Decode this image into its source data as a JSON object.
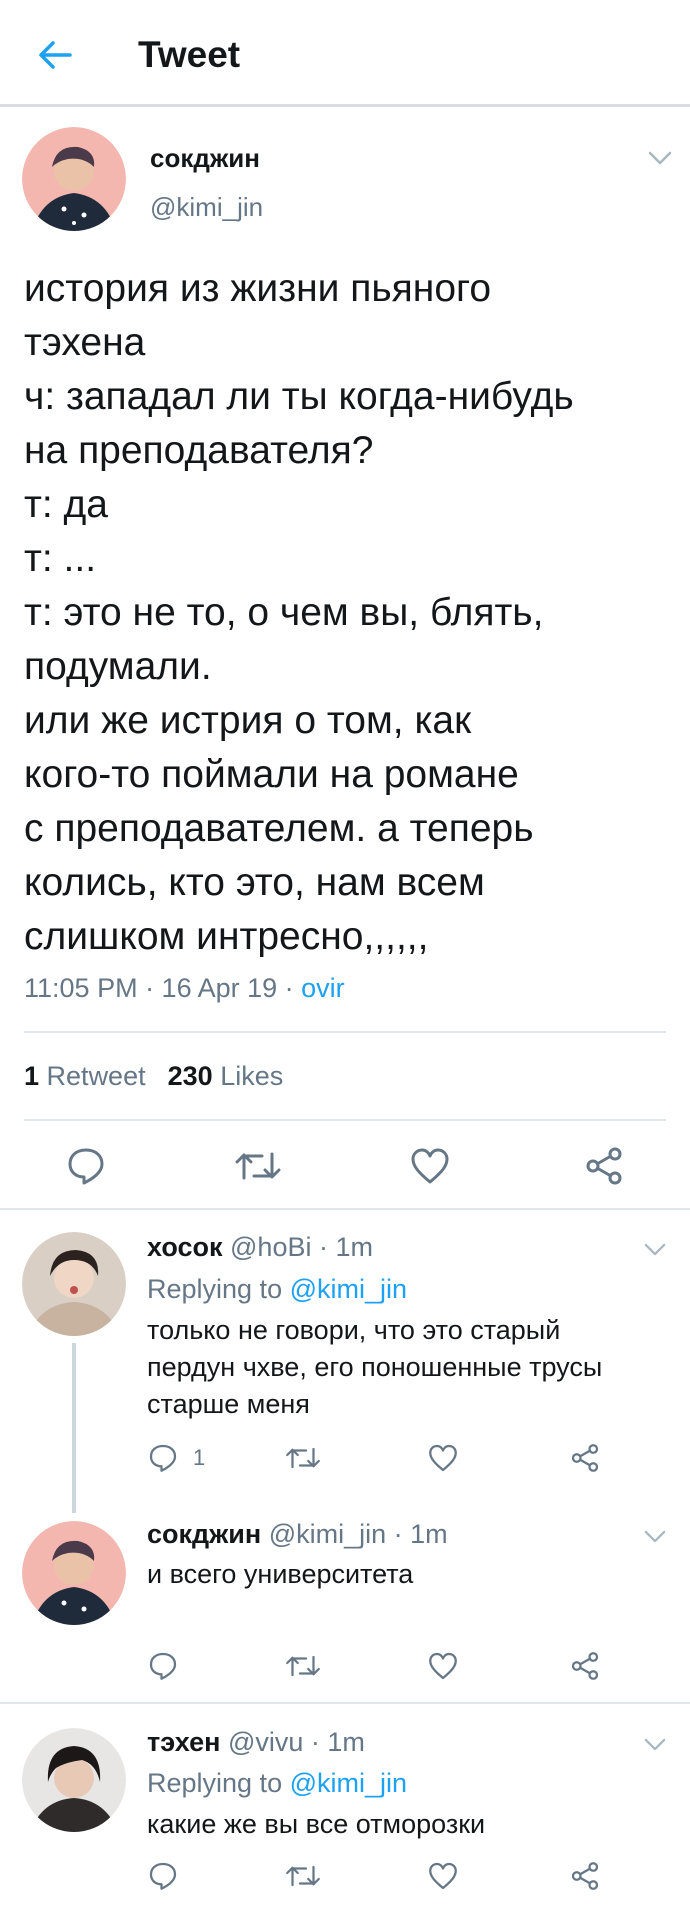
{
  "header": {
    "title": "Tweet",
    "back_icon": "arrow-left-icon"
  },
  "main_tweet": {
    "author_name": "сокджин",
    "author_handle": "@kimi_jin",
    "text_lines": [
      "история из жизни пьяного",
      "тэхена",
      "ч: западал ли ты когда-нибудь",
      "на преподавателя?",
      "т: да",
      "т: ...",
      "т: это не то, о чем вы, блять,",
      "подумали.",
      "или же истрия о том, как",
      "кого-то поймали на романе",
      "с преподавателем. а теперь",
      "колись, кто это, нам всем",
      "слишком интресно,,,,,,"
    ],
    "timestamp": "11:05 PM · 16 Apr 19 · ",
    "via": "ovir",
    "retweets_count": "1",
    "retweets_label": "Retweet",
    "likes_count": "230",
    "likes_label": "Likes"
  },
  "replies": [
    {
      "name": "хосок",
      "handle_time": " @hoBi · 1m",
      "replying_prefix": "Replying to ",
      "replying_to": "@kimi_jin",
      "text_lines": [
        "только не говори, что это старый",
        "пердун чхве, его поношенные трусы",
        "старше меня"
      ],
      "reply_count": "1"
    },
    {
      "name": "сокджин",
      "handle_time": " @kimi_jin · 1m",
      "text_lines": [
        "и всего университета"
      ],
      "reply_count": ""
    },
    {
      "name": "тэхен",
      "handle_time": " @vivu · 1m",
      "replying_prefix": "Replying to ",
      "replying_to": "@kimi_jin",
      "text_lines": [
        "какие же вы все отморозки"
      ],
      "reply_count": ""
    }
  ],
  "colors": {
    "accent": "#1da1f2",
    "secondary_text": "#657786",
    "divider": "#e1e8ed"
  }
}
